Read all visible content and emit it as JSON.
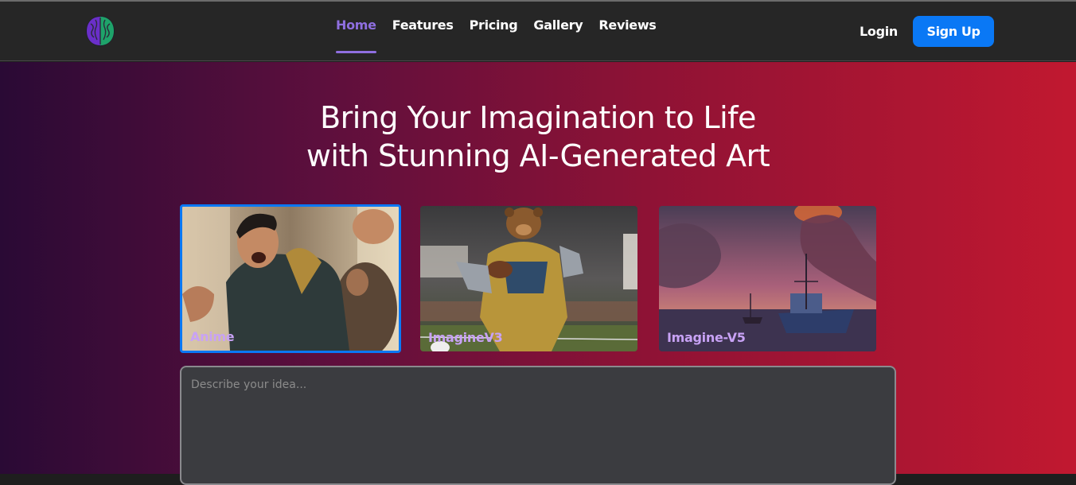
{
  "nav": {
    "links": [
      {
        "label": "Home",
        "active": true
      },
      {
        "label": "Features",
        "active": false
      },
      {
        "label": "Pricing",
        "active": false
      },
      {
        "label": "Gallery",
        "active": false
      },
      {
        "label": "Reviews",
        "active": false
      }
    ],
    "login_label": "Login",
    "signup_label": "Sign Up",
    "accent_color": "#8f6fe0",
    "signup_color": "#0a78f5"
  },
  "hero": {
    "headline_line1": "Bring Your Imagination to Life",
    "headline_line2": "with Stunning AI-Generated Art"
  },
  "models": [
    {
      "label": "Anime",
      "selected": true,
      "icon": "anime-fighter-image"
    },
    {
      "label": "ImagineV3",
      "selected": false,
      "icon": "robot-bear-football-image"
    },
    {
      "label": "Imagine-V5",
      "selected": false,
      "icon": "ship-sunset-image"
    }
  ],
  "prompt": {
    "placeholder": "Describe your idea..."
  }
}
